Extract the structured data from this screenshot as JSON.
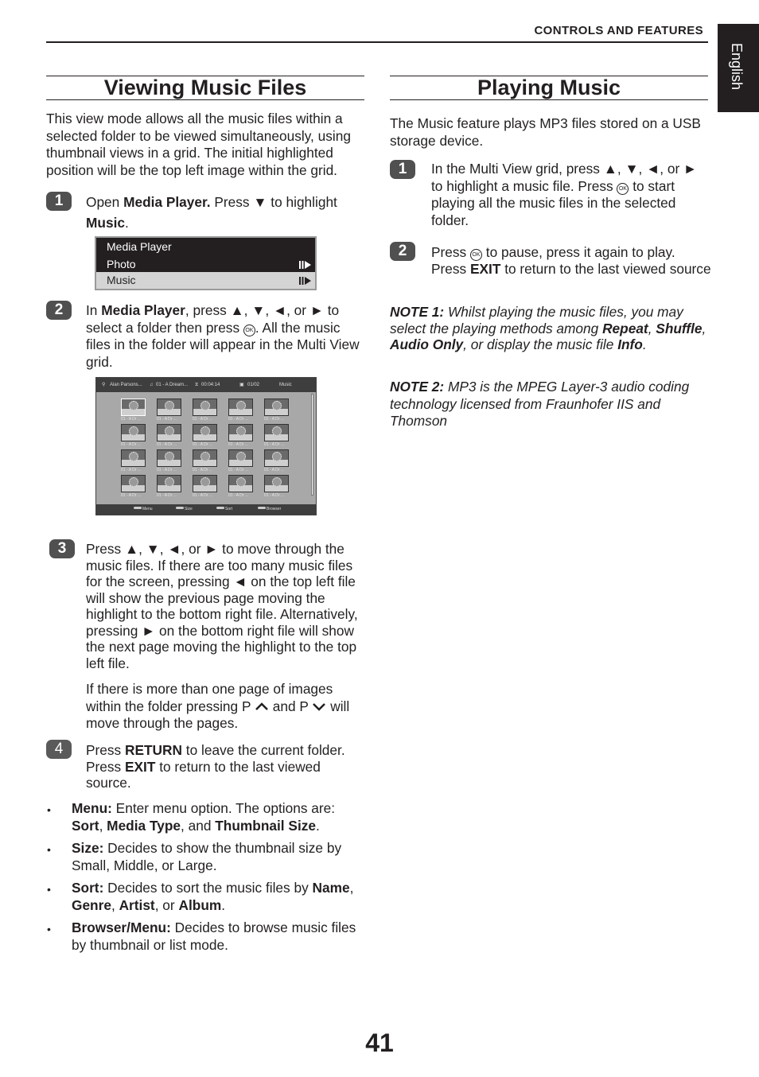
{
  "header": {
    "section_label": "CONTROLS AND FEATURES",
    "language_tab": "English"
  },
  "left": {
    "title": "Viewing Music Files",
    "intro": "This view mode allows all the music files within a selected folder to be viewed simultaneously, using thumbnail views in a grid. The initial highlighted position will be the top left image within the grid.",
    "step1": {
      "number": "1",
      "text_a": "Open ",
      "bold_a": "Media Player.",
      "text_b": " Press ▼ to highlight ",
      "bold_b": "Music",
      "text_c": "."
    },
    "media_player_menu": {
      "title": "Media Player",
      "items": [
        {
          "label": "Photo",
          "highlighted": false,
          "icon": "play-arrow-icon"
        },
        {
          "label": "Music",
          "highlighted": true,
          "icon": "play-arrow-icon"
        }
      ]
    },
    "step2": {
      "number": "2",
      "text_a": "In ",
      "bold_a": "Media Player",
      "text_b": ", press ▲, ▼, ◄, or ► to select a folder then press ",
      "ok": "OK",
      "text_c": ". All the music files in the folder will appear in the Multi View grid."
    },
    "multi_view": {
      "artist": "Alan Parsons...",
      "track": "01 - A Dream...",
      "duration": "00:04:14",
      "page": "01/02",
      "media_type": "Music",
      "thumb_caption": "01 - A Dr ...",
      "rows": 4,
      "cols": 5,
      "selected_index": 0,
      "footer_keys": [
        "Menu",
        "Size",
        "Sort",
        "Browser"
      ]
    },
    "step3": {
      "number": "3",
      "text": "Press ▲, ▼, ◄, or ► to move through the music files. If there are too many music files for the screen, pressing ◄ on the top left file will show the previous page moving the highlight to the bottom right file. Alternatively, pressing ► on the bottom right file will show the next page moving the highlight to the top left file.",
      "para2_a": "If there is more than one page of images within the folder pressing P ",
      "para2_b": " and P ",
      "para2_c": " will move through the pages."
    },
    "step4": {
      "number": "4",
      "text_a": "Press ",
      "bold_a": "RETURN",
      "text_b": " to leave the current folder. Press ",
      "bold_b": "EXIT",
      "text_c": " to return to the last viewed source."
    },
    "bullets": [
      {
        "label": "Menu:",
        "text_a": " Enter menu option. The options are: ",
        "b1": "Sort",
        "t1": ", ",
        "b2": "Media Type",
        "t2": ", and ",
        "b3": "Thumbnail Size",
        "t3": "."
      },
      {
        "label": "Size:",
        "text_a": " Decides to show the thumbnail size by Small, Middle, or Large."
      },
      {
        "label": "Sort:",
        "text_a": " Decides to sort the music files by ",
        "b1": "Name",
        "t1": ", ",
        "b2": "Genre",
        "t2": ", ",
        "b3": "Artist",
        "t3": ", or ",
        "b4": "Album",
        "t4": "."
      },
      {
        "label": "Browser/Menu:",
        "text_a": " Decides to browse music files by thumbnail or list mode."
      }
    ]
  },
  "right": {
    "title": "Playing Music",
    "intro": "The Music feature plays MP3 files stored on a USB storage device.",
    "step1": {
      "number": "1",
      "text_a": "In the Multi View grid, press ▲, ▼, ◄, or ► to highlight a music file. Press ",
      "ok": "OK",
      "text_b": " to start playing all the music files in the selected folder."
    },
    "step2": {
      "number": "2",
      "text_a": "Press ",
      "ok": "OK",
      "text_b": " to pause, press it again to play. Press ",
      "bold_a": "EXIT",
      "text_c": " to return to the last viewed source"
    },
    "note1": {
      "label": "NOTE 1:",
      "text_a": " Whilst playing the music files, you may select the playing methods among ",
      "b1": "Repeat",
      "t1": ", ",
      "b2": "Shuffle",
      "t2": ", ",
      "b3": "Audio Only",
      "t3": ", or display the music file ",
      "b4": "Info",
      "t4": "."
    },
    "note2": {
      "label": "NOTE 2:",
      "text": " MP3 is the MPEG Layer-3 audio coding technology licensed from Fraunhofer IIS and Thomson"
    }
  },
  "page_number": "41"
}
